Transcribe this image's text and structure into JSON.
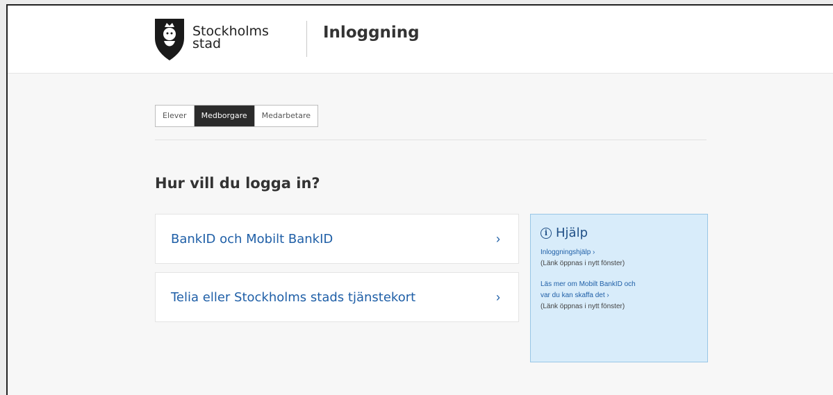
{
  "header": {
    "logo_line1": "Stockholms",
    "logo_line2": "stad",
    "title": "Inloggning"
  },
  "tabs": [
    {
      "label": "Elever",
      "active": false
    },
    {
      "label": "Medborgare",
      "active": true
    },
    {
      "label": "Medarbetare",
      "active": false
    }
  ],
  "main": {
    "question": "Hur vill du logga in?",
    "options": [
      {
        "label": "BankID och Mobilt BankID",
        "chevron": "›"
      },
      {
        "label": "Telia eller Stockholms stads tjänstekort",
        "chevron": "›"
      }
    ]
  },
  "help": {
    "icon": "ⓘ",
    "title": "Hjälp",
    "link1": "Inloggningshjälp ›",
    "note1": "(Länk öppnas i nytt fönster)",
    "link2_line1": "Läs mer om Mobilt BankID och",
    "link2_line2": "var du kan skaffa det ›",
    "note2": "(Länk öppnas i nytt fönster)"
  },
  "colors": {
    "link": "#1f5fa7",
    "help_bg": "#d8ecfa",
    "active_tab": "#2b2b2b"
  }
}
